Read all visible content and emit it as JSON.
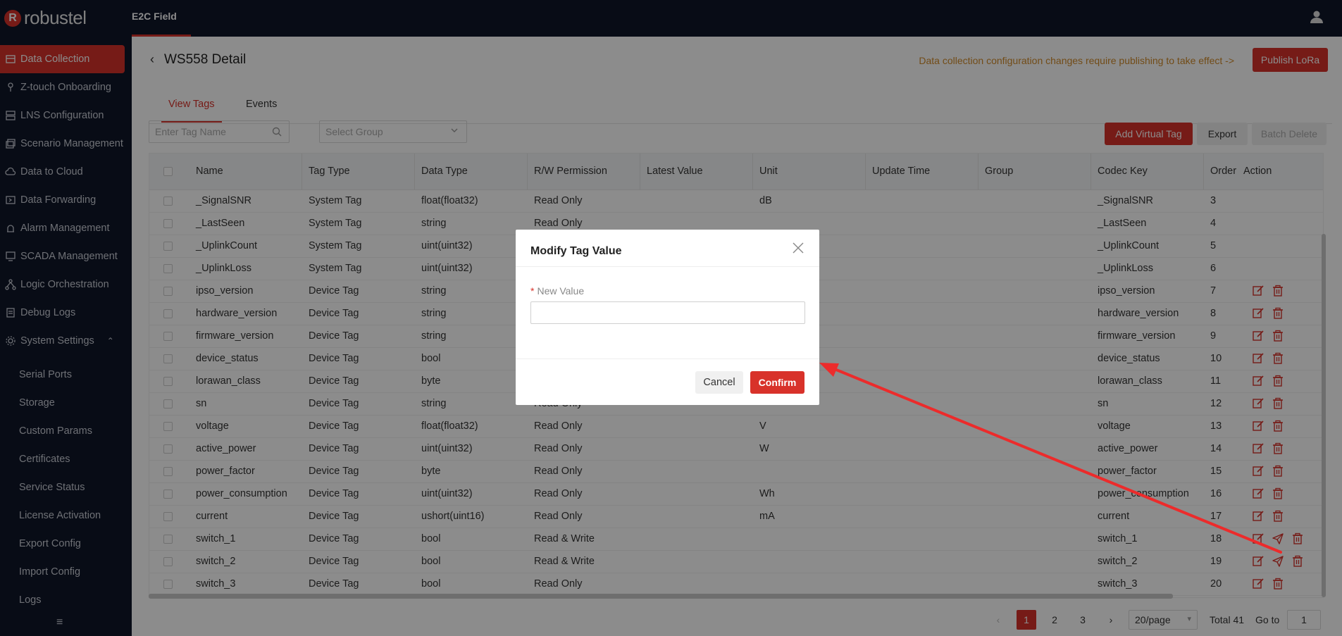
{
  "app": {
    "brand": "robustel",
    "brand_mark": "R",
    "tab": "E2C Field"
  },
  "colors": {
    "accent": "#d8322a",
    "sidebar_bg": "#0f1629",
    "notice": "#d08a2a",
    "annotation_arrow": "#ec2b2b"
  },
  "sidebar": {
    "items": [
      {
        "label": "Data Collection",
        "icon": "database-icon",
        "active": true
      },
      {
        "label": "Z-touch Onboarding",
        "icon": "touch-icon"
      },
      {
        "label": "LNS Configuration",
        "icon": "server-icon"
      },
      {
        "label": "Scenario Management",
        "icon": "layers-icon"
      },
      {
        "label": "Data to Cloud",
        "icon": "cloud-icon"
      },
      {
        "label": "Data Forwarding",
        "icon": "forward-icon"
      },
      {
        "label": "Alarm Management",
        "icon": "alarm-icon"
      },
      {
        "label": "SCADA Management",
        "icon": "monitor-icon"
      },
      {
        "label": "Logic Orchestration",
        "icon": "flow-icon"
      },
      {
        "label": "Debug Logs",
        "icon": "log-icon"
      },
      {
        "label": "System Settings",
        "icon": "gear-icon",
        "expanded": true
      }
    ],
    "subitems": [
      "Serial Ports",
      "Storage",
      "Custom Params",
      "Certificates",
      "Service Status",
      "License Activation",
      "Export Config",
      "Import Config",
      "Logs"
    ]
  },
  "page": {
    "title": "WS558 Detail",
    "notice": "Data collection configuration changes require publishing to take effect ->",
    "publish_label": "Publish LoRa",
    "tabs": [
      "View Tags",
      "Events"
    ],
    "active_tab": 0
  },
  "toolbar": {
    "search_placeholder": "Enter Tag Name",
    "group_placeholder": "Select Group",
    "add_virtual": "Add Virtual Tag",
    "export": "Export",
    "batch_delete": "Batch Delete"
  },
  "table": {
    "columns": [
      "Name",
      "Tag Type",
      "Data Type",
      "R/W Permission",
      "Latest Value",
      "Unit",
      "Update Time",
      "Group",
      "Codec Key",
      "Order",
      "Action"
    ],
    "rows": [
      {
        "name": "_SignalSNR",
        "tag_type": "System Tag",
        "data_type": "float(float32)",
        "rw": "Read Only",
        "latest": "",
        "unit": "dB",
        "update": "",
        "group": "",
        "codec": "_SignalSNR",
        "order": "3",
        "actions": []
      },
      {
        "name": "_LastSeen",
        "tag_type": "System Tag",
        "data_type": "string",
        "rw": "Read Only",
        "latest": "",
        "unit": "",
        "update": "",
        "group": "",
        "codec": "_LastSeen",
        "order": "4",
        "actions": []
      },
      {
        "name": "_UplinkCount",
        "tag_type": "System Tag",
        "data_type": "uint(uint32)",
        "rw": "",
        "latest": "",
        "unit": "",
        "update": "",
        "group": "",
        "codec": "_UplinkCount",
        "order": "5",
        "actions": []
      },
      {
        "name": "_UplinkLoss",
        "tag_type": "System Tag",
        "data_type": "uint(uint32)",
        "rw": "",
        "latest": "",
        "unit": "",
        "update": "",
        "group": "",
        "codec": "_UplinkLoss",
        "order": "6",
        "actions": []
      },
      {
        "name": "ipso_version",
        "tag_type": "Device Tag",
        "data_type": "string",
        "rw": "",
        "latest": "",
        "unit": "",
        "update": "",
        "group": "",
        "codec": "ipso_version",
        "order": "7",
        "actions": [
          "edit",
          "delete"
        ]
      },
      {
        "name": "hardware_version",
        "tag_type": "Device Tag",
        "data_type": "string",
        "rw": "",
        "latest": "",
        "unit": "",
        "update": "",
        "group": "",
        "codec": "hardware_version",
        "order": "8",
        "actions": [
          "edit",
          "delete"
        ]
      },
      {
        "name": "firmware_version",
        "tag_type": "Device Tag",
        "data_type": "string",
        "rw": "",
        "latest": "",
        "unit": "",
        "update": "",
        "group": "",
        "codec": "firmware_version",
        "order": "9",
        "actions": [
          "edit",
          "delete"
        ]
      },
      {
        "name": "device_status",
        "tag_type": "Device Tag",
        "data_type": "bool",
        "rw": "",
        "latest": "",
        "unit": "",
        "update": "",
        "group": "",
        "codec": "device_status",
        "order": "10",
        "actions": [
          "edit",
          "delete"
        ]
      },
      {
        "name": "lorawan_class",
        "tag_type": "Device Tag",
        "data_type": "byte",
        "rw": "",
        "latest": "",
        "unit": "",
        "update": "",
        "group": "",
        "codec": "lorawan_class",
        "order": "11",
        "actions": [
          "edit",
          "delete"
        ]
      },
      {
        "name": "sn",
        "tag_type": "Device Tag",
        "data_type": "string",
        "rw": "Read Only",
        "latest": "",
        "unit": "",
        "update": "",
        "group": "",
        "codec": "sn",
        "order": "12",
        "actions": [
          "edit",
          "delete"
        ]
      },
      {
        "name": "voltage",
        "tag_type": "Device Tag",
        "data_type": "float(float32)",
        "rw": "Read Only",
        "latest": "",
        "unit": "V",
        "update": "",
        "group": "",
        "codec": "voltage",
        "order": "13",
        "actions": [
          "edit",
          "delete"
        ]
      },
      {
        "name": "active_power",
        "tag_type": "Device Tag",
        "data_type": "uint(uint32)",
        "rw": "Read Only",
        "latest": "",
        "unit": "W",
        "update": "",
        "group": "",
        "codec": "active_power",
        "order": "14",
        "actions": [
          "edit",
          "delete"
        ]
      },
      {
        "name": "power_factor",
        "tag_type": "Device Tag",
        "data_type": "byte",
        "rw": "Read Only",
        "latest": "",
        "unit": "",
        "update": "",
        "group": "",
        "codec": "power_factor",
        "order": "15",
        "actions": [
          "edit",
          "delete"
        ]
      },
      {
        "name": "power_consumption",
        "tag_type": "Device Tag",
        "data_type": "uint(uint32)",
        "rw": "Read Only",
        "latest": "",
        "unit": "Wh",
        "update": "",
        "group": "",
        "codec": "power_consumption",
        "order": "16",
        "actions": [
          "edit",
          "delete"
        ]
      },
      {
        "name": "current",
        "tag_type": "Device Tag",
        "data_type": "ushort(uint16)",
        "rw": "Read Only",
        "latest": "",
        "unit": "mA",
        "update": "",
        "group": "",
        "codec": "current",
        "order": "17",
        "actions": [
          "edit",
          "delete"
        ]
      },
      {
        "name": "switch_1",
        "tag_type": "Device Tag",
        "data_type": "bool",
        "rw": "Read & Write",
        "latest": "",
        "unit": "",
        "update": "",
        "group": "",
        "codec": "switch_1",
        "order": "18",
        "actions": [
          "edit",
          "send",
          "delete"
        ]
      },
      {
        "name": "switch_2",
        "tag_type": "Device Tag",
        "data_type": "bool",
        "rw": "Read & Write",
        "latest": "",
        "unit": "",
        "update": "",
        "group": "",
        "codec": "switch_2",
        "order": "19",
        "actions": [
          "edit",
          "send",
          "delete"
        ]
      },
      {
        "name": "switch_3",
        "tag_type": "Device Tag",
        "data_type": "bool",
        "rw": "Read Only",
        "latest": "",
        "unit": "",
        "update": "",
        "group": "",
        "codec": "switch_3",
        "order": "20",
        "actions": [
          "edit",
          "delete"
        ]
      }
    ]
  },
  "pagination": {
    "pages": [
      "1",
      "2",
      "3"
    ],
    "current": "1",
    "per_page": "20/page",
    "total": "Total 41",
    "goto_label": "Go to",
    "goto_value": "1"
  },
  "modal": {
    "title": "Modify Tag Value",
    "field_label": "New Value",
    "field_required": "*",
    "field_value": "",
    "cancel": "Cancel",
    "confirm": "Confirm"
  }
}
